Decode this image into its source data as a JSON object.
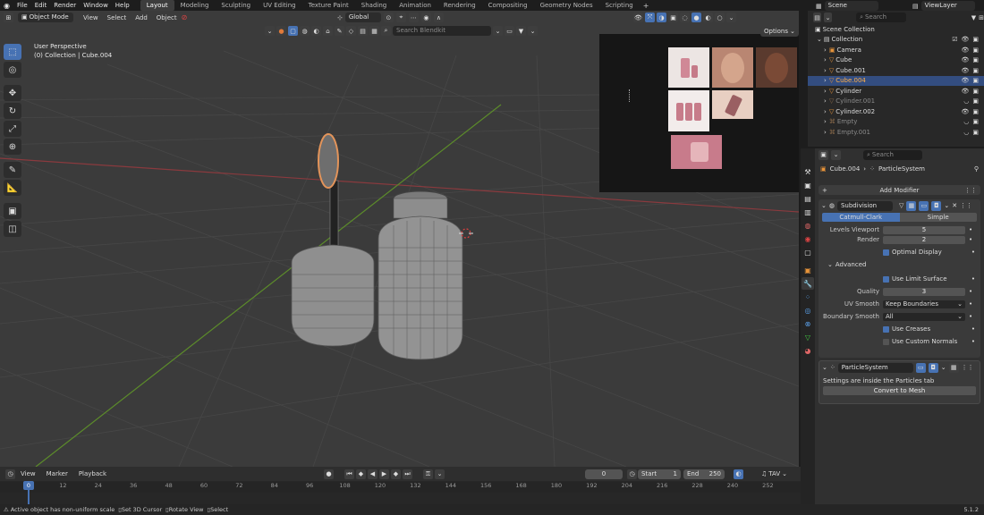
{
  "menu": [
    "File",
    "Edit",
    "Render",
    "Window",
    "Help"
  ],
  "workspaces": [
    "Layout",
    "Modeling",
    "Sculpting",
    "UV Editing",
    "Texture Paint",
    "Shading",
    "Animation",
    "Rendering",
    "Compositing",
    "Geometry Nodes",
    "Scripting"
  ],
  "active_workspace": "Layout",
  "scene": {
    "name": "Scene",
    "view_layer": "ViewLayer"
  },
  "viewport_header": {
    "mode": "Object Mode",
    "menus": [
      "View",
      "Select",
      "Add",
      "Object"
    ],
    "orientation": "Global",
    "options": "Options",
    "search_placeholder": "Search Blendkit"
  },
  "viewport_overlay": {
    "perspective": "User Perspective",
    "collection_info": "(0) Collection | Cube.004"
  },
  "outliner": {
    "search_placeholder": "Search",
    "root": "Scene Collection",
    "collection": "Collection",
    "items": [
      {
        "name": "Camera",
        "selected": false,
        "dim": false
      },
      {
        "name": "Cube",
        "selected": false,
        "dim": false
      },
      {
        "name": "Cube.001",
        "selected": false,
        "dim": false
      },
      {
        "name": "Cube.004",
        "selected": true,
        "dim": false
      },
      {
        "name": "Cylinder",
        "selected": false,
        "dim": false
      },
      {
        "name": "Cylinder.001",
        "selected": false,
        "dim": true
      },
      {
        "name": "Cylinder.002",
        "selected": false,
        "dim": false
      },
      {
        "name": "Empty",
        "selected": false,
        "dim": true
      },
      {
        "name": "Empty.001",
        "selected": false,
        "dim": true
      }
    ]
  },
  "properties": {
    "search_placeholder": "Search",
    "breadcrumb_object": "Cube.004",
    "breadcrumb_modifier": "ParticleSystem",
    "add_modifier": "Add Modifier",
    "subdivision": {
      "name": "Subdivision",
      "method_a": "Catmull-Clark",
      "method_b": "Simple",
      "levels_viewport_label": "Levels Viewport",
      "levels_viewport": "5",
      "render_label": "Render",
      "render": "2",
      "optimal_display": "Optimal Display",
      "advanced": "Advanced",
      "use_limit_surface": "Use Limit Surface",
      "quality_label": "Quality",
      "quality": "3",
      "uv_smooth_label": "UV Smooth",
      "uv_smooth": "Keep Boundaries",
      "boundary_smooth_label": "Boundary Smooth",
      "boundary_smooth": "All",
      "use_creases": "Use Creases",
      "use_custom_normals": "Use Custom Normals"
    },
    "particle": {
      "name": "ParticleSystem",
      "info": "Settings are inside the Particles tab",
      "convert": "Convert to Mesh"
    }
  },
  "timeline": {
    "menus": [
      "View",
      "Marker",
      "Playback"
    ],
    "current_frame": "0",
    "start_label": "Start",
    "start": "1",
    "end_label": "End",
    "end": "250",
    "tav": "TAV",
    "ticks": [
      "0",
      "12",
      "24",
      "36",
      "48",
      "60",
      "72",
      "84",
      "96",
      "108",
      "120",
      "132",
      "144",
      "156",
      "168",
      "180",
      "192",
      "204",
      "216",
      "228",
      "240",
      "252"
    ]
  },
  "status": {
    "message": "Active object has non-uniform scale",
    "hint1": "Set 3D Cursor",
    "hint2": "Rotate View",
    "hint3": "Select",
    "version": "5.1.2"
  }
}
